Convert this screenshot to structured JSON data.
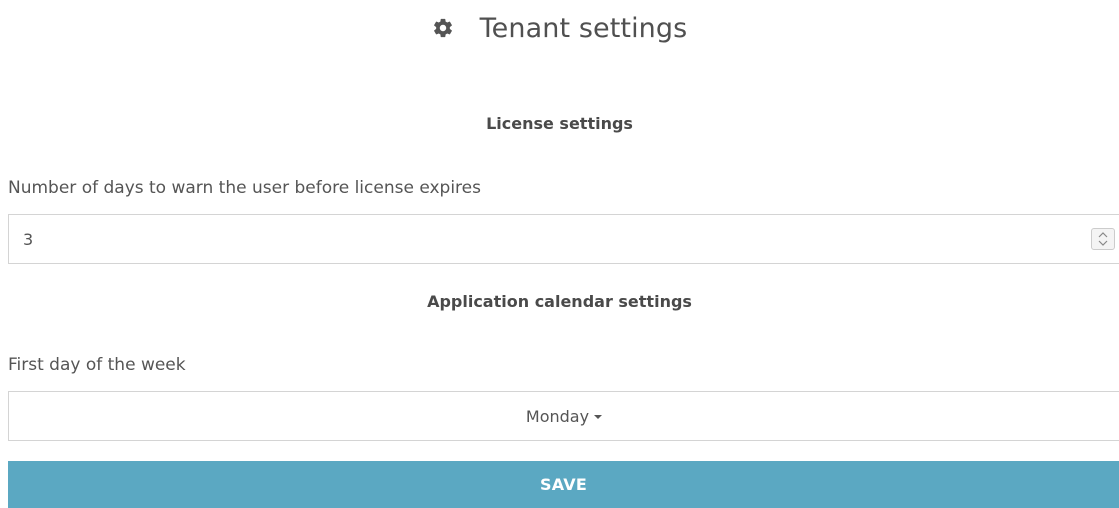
{
  "header": {
    "title": "Tenant settings",
    "icon": "gear-icon"
  },
  "license": {
    "section_title": "License settings",
    "days_label": "Number of days to warn the user before license expires",
    "days_value": "3"
  },
  "calendar": {
    "section_title": "Application calendar settings",
    "first_day_label": "First day of the week",
    "first_day_value": "Monday"
  },
  "actions": {
    "save_label": "SAVE"
  },
  "colors": {
    "save_button": "#5ba8c2",
    "text": "#4a4a4a",
    "border": "#d4d4d4"
  }
}
